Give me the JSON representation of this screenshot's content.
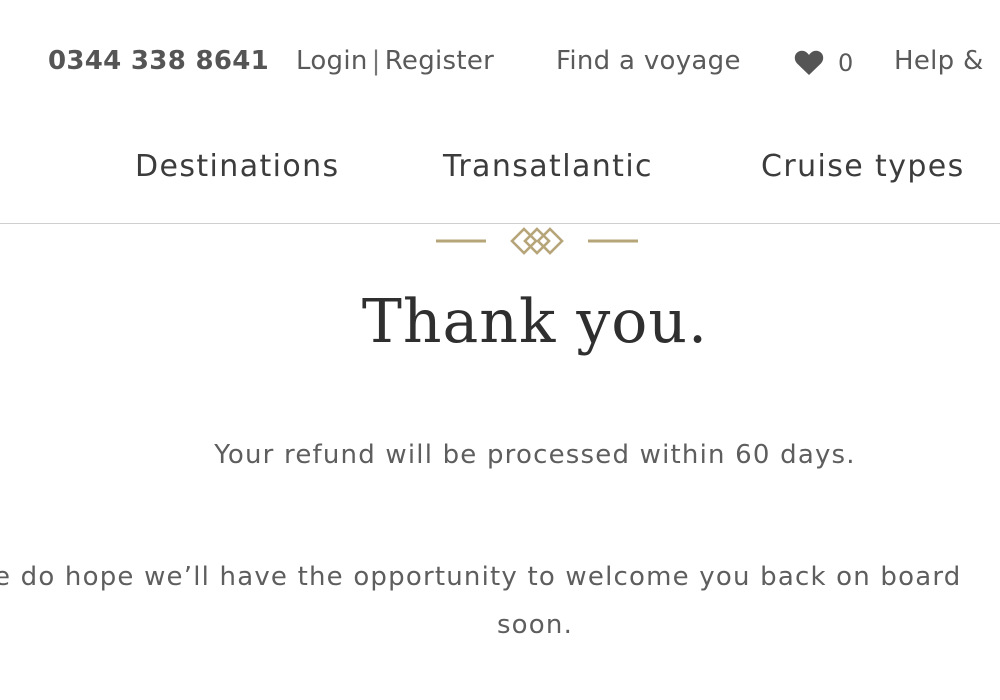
{
  "header": {
    "phone": "0344 338 8641",
    "login_label": "Login",
    "separator": "|",
    "register_label": "Register",
    "find_voyage_label": "Find a voyage",
    "wishlist_count": "0",
    "help_label": "Help &"
  },
  "nav": {
    "items": [
      "Destinations",
      "Transatlantic",
      "Cruise types"
    ]
  },
  "confirmation": {
    "title": "Thank you.",
    "refund_message": "Your refund will be processed within 60 days.",
    "hope_line_1": "e do hope we’ll have the opportunity to welcome you back on board",
    "hope_line_2": "soon."
  },
  "colors": {
    "accent_gold": "#b7a57a",
    "text": "#5a5a5a",
    "heart": "#555555"
  },
  "icons": {
    "wishlist": "heart-icon",
    "ornament": "diamond-ornament"
  }
}
